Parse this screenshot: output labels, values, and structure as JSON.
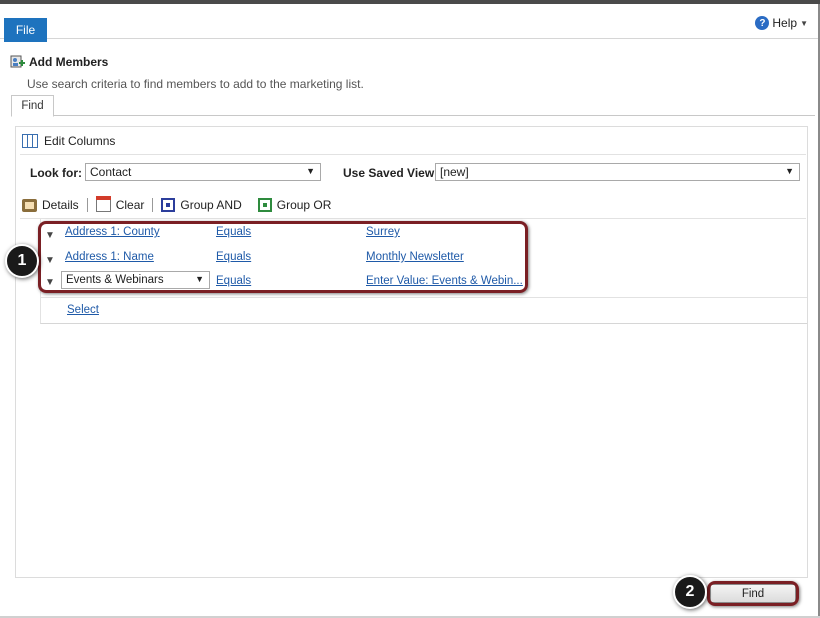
{
  "ribbon": {
    "file_label": "File",
    "help_label": "Help"
  },
  "dialog": {
    "title": "Add Members",
    "subtitle": "Use search criteria to find members to add to the marketing list.",
    "tab_find": "Find"
  },
  "query": {
    "edit_columns": "Edit Columns",
    "look_for_label": "Look for:",
    "look_for_value": "Contact",
    "saved_view_label": "Use Saved View:",
    "saved_view_value": "[new]"
  },
  "toolbar": {
    "details": "Details",
    "clear": "Clear",
    "group_and": "Group AND",
    "group_or": "Group OR"
  },
  "criteria": [
    {
      "field": "Address 1: County",
      "operator": "Equals",
      "value": "Surrey"
    },
    {
      "field": "Address 1: Name",
      "operator": "Equals",
      "value": "Monthly Newsletter"
    },
    {
      "field": "Events & Webinars",
      "operator": "Equals",
      "value": "Enter Value: Events & Webin..."
    }
  ],
  "select_label": "Select",
  "find_button": "Find",
  "badges": {
    "one": "1",
    "two": "2"
  },
  "colors": {
    "file_tab": "#1e73be",
    "link": "#1f5aa8",
    "highlight": "#7a1f24"
  }
}
